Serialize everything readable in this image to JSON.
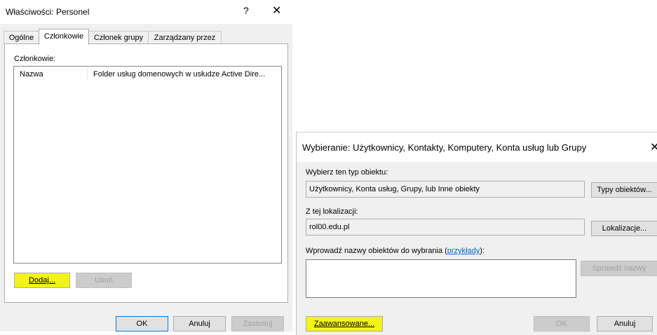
{
  "dialog1": {
    "title": "Właściwości: Personel",
    "help_glyph": "?",
    "close_glyph": "✕",
    "tabs": [
      {
        "label": "Ogólne"
      },
      {
        "label": "Członkowie"
      },
      {
        "label": "Członek grupy"
      },
      {
        "label": "Zarządzany przez"
      }
    ],
    "members_label": "Członkowie:",
    "list_columns": [
      "Nazwa",
      "Folder usług domenowych w usłudze Active Dire..."
    ],
    "add_button": "Dodaj...",
    "remove_button": "Usuń",
    "ok_button": "OK",
    "cancel_button": "Anuluj",
    "apply_button": "Zastosuj"
  },
  "dialog2": {
    "title": "Wybieranie: Użytkownicy, Kontakty, Komputery, Konta usług lub Grupy",
    "close_glyph": "✕",
    "object_type_label": "Wybierz ten typ obiektu:",
    "object_type_value": "Użytkownicy, Konta usług, Grupy, lub Inne obiekty",
    "object_types_button": "Typy obiektów...",
    "location_label": "Z tej lokalizacji:",
    "location_value": "rol00.edu.pl",
    "locations_button": "Lokalizacje...",
    "names_label": "Wprowadź nazwy obiektów do wybrania (",
    "examples_link": "przykłady",
    "names_label_end": "):",
    "check_names_button": "Sprawdź nazwy",
    "advanced_button": "Zaawansowane...",
    "ok_button": "OK",
    "cancel_button": "Anuluj"
  },
  "colors": {
    "highlight": "#f3f31a",
    "dialog_bg": "#f0f0f0",
    "default_button_border": "#0078d7",
    "link": "#0066cc"
  }
}
